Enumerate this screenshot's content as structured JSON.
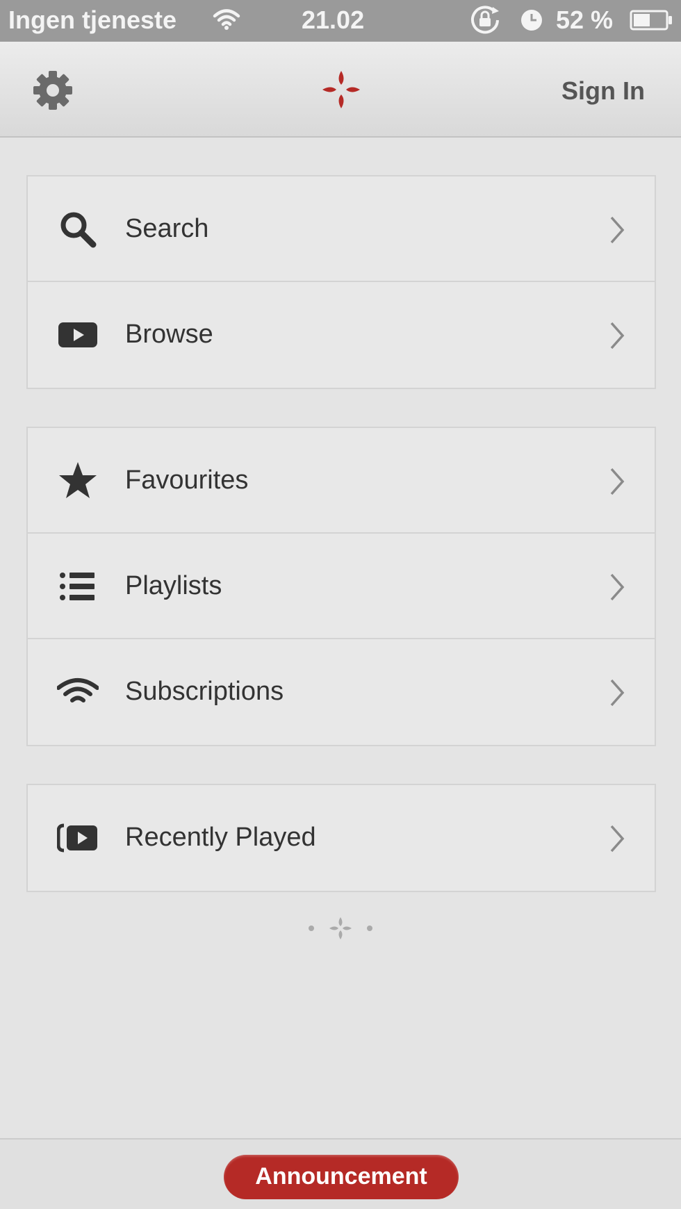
{
  "status_bar": {
    "carrier": "Ingen tjeneste",
    "time": "21.02",
    "battery_percent": "52 %",
    "battery_level": 0.52
  },
  "nav": {
    "sign_in_label": "Sign In"
  },
  "menu": {
    "group1": [
      {
        "label": "Search",
        "icon": "search-icon"
      },
      {
        "label": "Browse",
        "icon": "play-box-icon"
      }
    ],
    "group2": [
      {
        "label": "Favourites",
        "icon": "star-icon"
      },
      {
        "label": "Playlists",
        "icon": "list-icon"
      },
      {
        "label": "Subscriptions",
        "icon": "wifi-icon"
      }
    ],
    "group3": [
      {
        "label": "Recently Played",
        "icon": "recent-play-icon"
      }
    ]
  },
  "bottom": {
    "announcement_label": "Announcement"
  },
  "colors": {
    "brand": "#b52a26",
    "background": "#e4e4e4",
    "text": "#333333"
  }
}
